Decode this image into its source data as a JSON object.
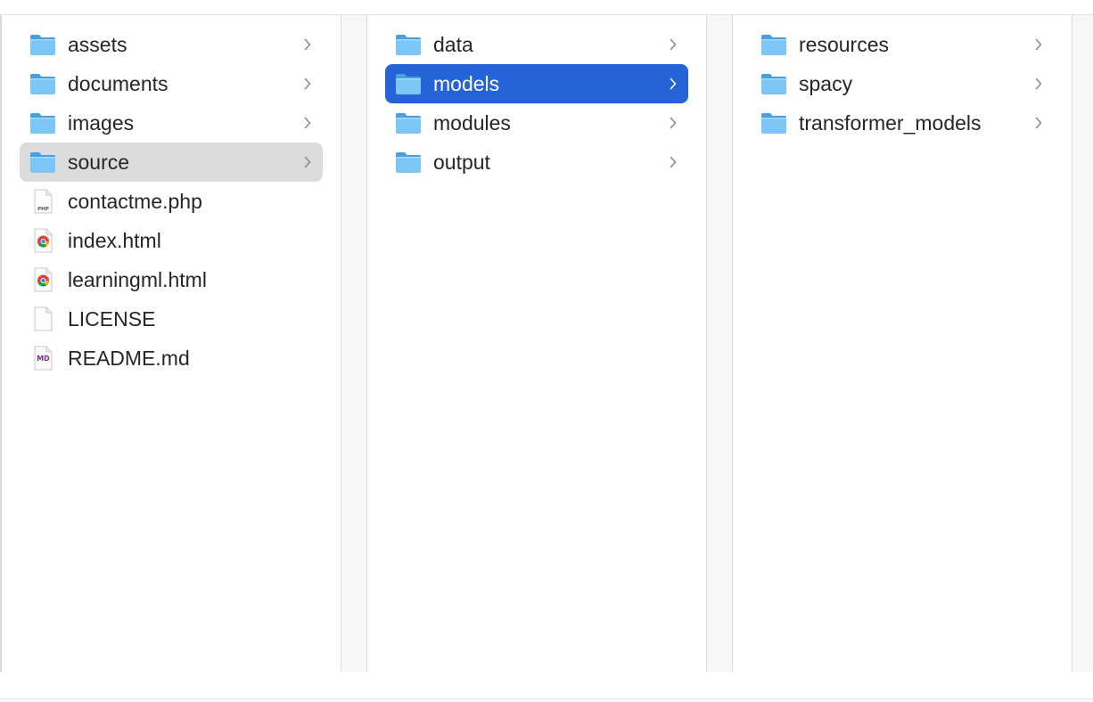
{
  "columns": [
    {
      "items": [
        {
          "label": "assets",
          "kind": "folder",
          "icon": "folder-icon",
          "has_children": true,
          "state": "normal"
        },
        {
          "label": "documents",
          "kind": "folder",
          "icon": "folder-icon",
          "has_children": true,
          "state": "normal"
        },
        {
          "label": "images",
          "kind": "folder",
          "icon": "folder-icon",
          "has_children": true,
          "state": "normal"
        },
        {
          "label": "source",
          "kind": "folder",
          "icon": "folder-icon",
          "has_children": true,
          "state": "selected-path"
        },
        {
          "label": "contactme.php",
          "kind": "file",
          "icon": "php-file-icon",
          "badge": "PHP",
          "has_children": false,
          "state": "normal"
        },
        {
          "label": "index.html",
          "kind": "file",
          "icon": "chrome-html-file-icon",
          "has_children": false,
          "state": "normal"
        },
        {
          "label": "learningml.html",
          "kind": "file",
          "icon": "chrome-html-file-icon",
          "has_children": false,
          "state": "normal"
        },
        {
          "label": "LICENSE",
          "kind": "file",
          "icon": "blank-file-icon",
          "has_children": false,
          "state": "normal"
        },
        {
          "label": "README.md",
          "kind": "file",
          "icon": "markdown-file-icon",
          "badge": "MD",
          "has_children": false,
          "state": "normal"
        }
      ]
    },
    {
      "items": [
        {
          "label": "data",
          "kind": "folder",
          "icon": "folder-icon",
          "has_children": true,
          "state": "normal"
        },
        {
          "label": "models",
          "kind": "folder",
          "icon": "folder-icon",
          "has_children": true,
          "state": "selected-focus"
        },
        {
          "label": "modules",
          "kind": "folder",
          "icon": "folder-icon",
          "has_children": true,
          "state": "normal"
        },
        {
          "label": "output",
          "kind": "folder",
          "icon": "folder-icon",
          "has_children": true,
          "state": "normal"
        }
      ]
    },
    {
      "items": [
        {
          "label": "resources",
          "kind": "folder",
          "icon": "folder-icon",
          "has_children": true,
          "state": "normal"
        },
        {
          "label": "spacy",
          "kind": "folder",
          "icon": "folder-icon",
          "has_children": true,
          "state": "normal"
        },
        {
          "label": "transformer_models",
          "kind": "folder",
          "icon": "folder-icon",
          "has_children": true,
          "state": "normal"
        }
      ]
    }
  ],
  "colors": {
    "selection_focus": "#2563d9",
    "selection_path": "#dcdcdc",
    "folder_body": "#7cc6f5",
    "folder_tab": "#4a9fe0"
  }
}
